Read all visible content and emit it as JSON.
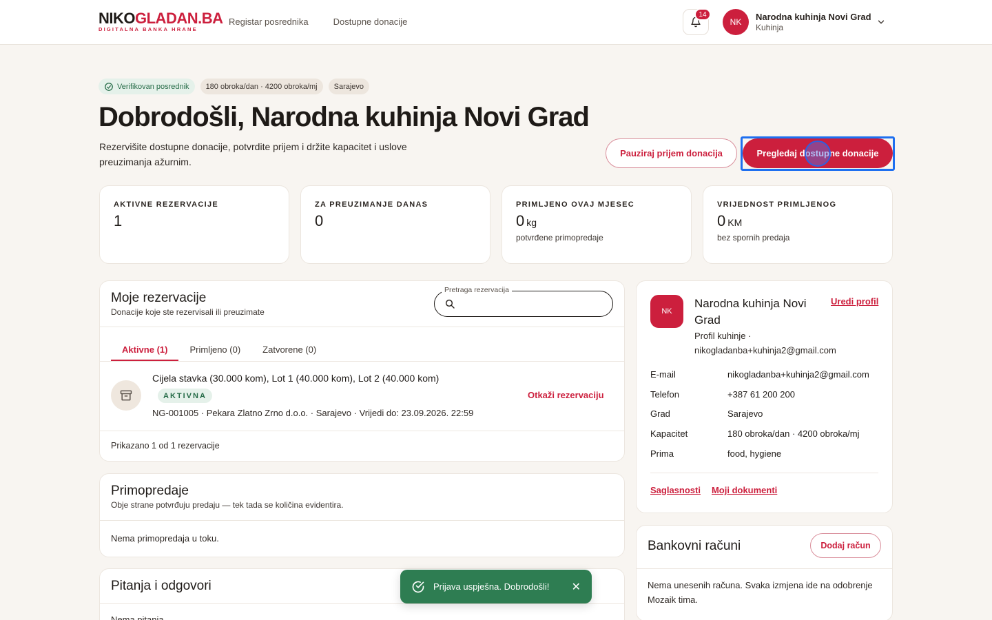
{
  "header": {
    "logo_main_dark": "NIKO",
    "logo_main_red": "GLADAN.BA",
    "logo_sub": "DIGITALNA BANKA HRANE",
    "nav": [
      "Registar posrednika",
      "Dostupne donacije"
    ],
    "notification_count": "14",
    "user_initials": "NK",
    "user_name": "Narodna kuhinja Novi Grad",
    "user_role": "Kuhinja"
  },
  "hero": {
    "chips": [
      "Verifikovan posrednik",
      "180 obroka/dan · 4200 obroka/mj",
      "Sarajevo"
    ],
    "title": "Dobrodošli, Narodna kuhinja Novi Grad",
    "subtitle": "Rezervišite dostupne donacije, potvrdite prijem i držite kapacitet i uslove preuzimanja ažurnim.",
    "pause_button": "Pauziraj prijem donacija",
    "browse_button": "Pregledaj dostupne donacije"
  },
  "stats": [
    {
      "label": "AKTIVNE REZERVACIJE",
      "value": "1",
      "unit": "",
      "note": ""
    },
    {
      "label": "ZA PREUZIMANJE DANAS",
      "value": "0",
      "unit": "",
      "note": ""
    },
    {
      "label": "PRIMLJENO OVAJ MJESEC",
      "value": "0",
      "unit": "kg",
      "note": "potvrđene primopredaje"
    },
    {
      "label": "VRIJEDNOST PRIMLJENOG",
      "value": "0",
      "unit": "KM",
      "note": "bez spornih predaja"
    }
  ],
  "reservations": {
    "title": "Moje rezervacije",
    "subtitle": "Donacije koje ste rezervisali ili preuzimate",
    "search_label": "Pretraga rezervacija",
    "search_value": "",
    "tabs": [
      "Aktivne (1)",
      "Primljeno (0)",
      "Zatvorene (0)"
    ],
    "item": {
      "title": "Cijela stavka (30.000 kom), Lot 1 (40.000 kom), Lot 2 (40.000 kom)",
      "status": "AKTIVNA",
      "meta": "NG-001005 · Pekara Zlatno Zrno d.o.o. · Sarajevo · Vrijedi do: 23.09.2026. 22:59",
      "cancel": "Otkaži rezervaciju"
    },
    "count": "Prikazano 1 od 1 rezervacije"
  },
  "handovers": {
    "title": "Primopredaje",
    "subtitle": "Obje strane potvrđuju predaju — tek tada se količina evidentira.",
    "empty": "Nema primopredaja u toku."
  },
  "qa": {
    "title": "Pitanja i odgovori",
    "empty": "Nema pitanja"
  },
  "profile": {
    "initials": "NK",
    "name": "Narodna kuhinja Novi Grad",
    "edit": "Uredi profil",
    "sub_line1": "Profil kuhinje ·",
    "sub_line2": "nikogladanba+kuhinja2@gmail.com",
    "rows": [
      {
        "k": "E-mail",
        "v": "nikogladanba+kuhinja2@gmail.com"
      },
      {
        "k": "Telefon",
        "v": "+387 61 200 200"
      },
      {
        "k": "Grad",
        "v": "Sarajevo"
      },
      {
        "k": "Kapacitet",
        "v": "180 obroka/dan · 4200 obroka/mj"
      },
      {
        "k": "Prima",
        "v": "food, hygiene"
      }
    ],
    "links": [
      "Saglasnosti",
      "Moji dokumenti"
    ]
  },
  "bank": {
    "title": "Bankovni računi",
    "add_button": "Dodaj račun",
    "empty": "Nema unesenih računa. Svaka izmjena ide na odobrenje Mozaik tima."
  },
  "toast": {
    "message": "Prijava uspješna. Dobrodošli!",
    "close": "✕"
  },
  "colors": {
    "brand_red": "#cc1f3d",
    "success_green": "#2e7d52",
    "page_bg": "#f8f5f1"
  }
}
